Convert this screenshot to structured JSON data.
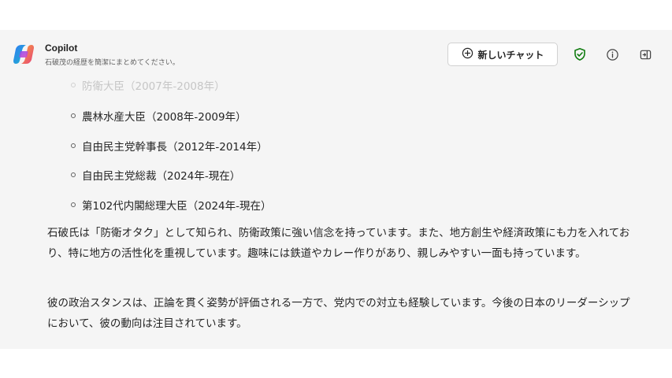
{
  "header": {
    "title": "Copilot",
    "subtitle": "石破茂の経歴を簡潔にまとめてください。",
    "new_chat_label": "新しいチャット",
    "icons": [
      "copilot-logo",
      "plus-circle-icon",
      "shield-check-icon",
      "info-icon",
      "side-panel-icon"
    ],
    "accent_shield": "#107c10"
  },
  "content": {
    "bullets": [
      "防衛大臣（2007年-2008年）",
      "農林水産大臣（2008年-2009年）",
      "自由民主党幹事長（2012年-2014年）",
      "自由民主党総裁（2024年-現在）",
      "第102代内閣総理大臣（2024年-現在）"
    ],
    "paragraphs": [
      "石破氏は「防衛オタク」として知られ、防衛政策に強い信念を持っています。また、地方創生や経済政策にも力を入れており、特に地方の活性化を重視しています。趣味には鉄道やカレー作りがあり、親しみやすい一面も持っています。",
      "彼の政治スタンスは、正論を貫く姿勢が評価される一方で、党内での対立も経験しています。今後の日本のリーダーシップにおいて、彼の動向は注目されています。"
    ]
  },
  "colors": {
    "panel_bg": "#f5f5f5",
    "text": "#242424",
    "muted": "#616161"
  }
}
